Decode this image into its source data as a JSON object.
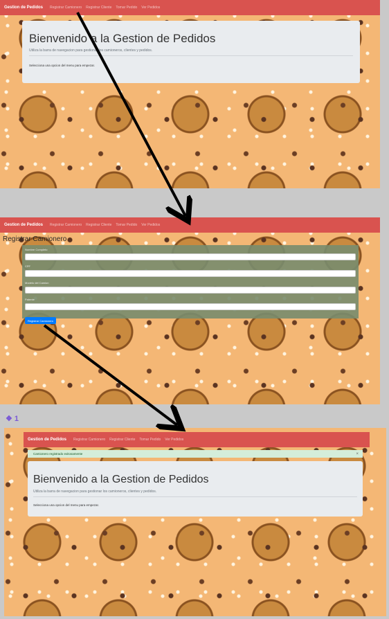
{
  "navbar": {
    "brand": "Gestion de Pedidos",
    "links": [
      "Registrar Camionero",
      "Registrar Cliente",
      "Tomar Pedido",
      "Ver Pedidos"
    ]
  },
  "home": {
    "title": "Bienvenido a la Gestion de Pedidos",
    "lead": "Utiliza la barra de navegacion para gestionar los camioneros, clientes y pedidos.",
    "hint": "Selecciona una opcion del menu para empezar."
  },
  "form": {
    "title": "Registrar Camionero",
    "fields": [
      {
        "label": "Nombre Completo"
      },
      {
        "label": "CPF"
      },
      {
        "label": "Modelo del Camion"
      },
      {
        "label": "Patente"
      }
    ],
    "submit_label": "Registrar Camionero"
  },
  "alert": {
    "message": "Camionero registrado exitosamente",
    "close": "×"
  },
  "marker": {
    "label": "❖ 1"
  },
  "colors": {
    "navbar": "#d9534f",
    "jumbotron": "#e9ecef",
    "form_panel": "#788c6e",
    "primary_button": "#007bff",
    "alert_success": "#d4edda",
    "arrow": "#000000"
  }
}
